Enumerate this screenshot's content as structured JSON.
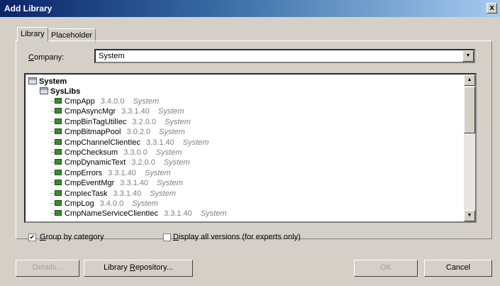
{
  "window": {
    "title": "Add Library",
    "close": "x"
  },
  "tabs": [
    {
      "label": "Library"
    },
    {
      "label": "Placeholder"
    }
  ],
  "company": {
    "label_u": "C",
    "label_rest": "ompany:",
    "value": "System",
    "dropdown_glyph": "▼"
  },
  "scroll": {
    "up": "▲",
    "down": "▼"
  },
  "tree": {
    "root": "System",
    "category": "SysLibs",
    "items": [
      {
        "name": "CmpApp",
        "version": "3.4.0.0",
        "vendor": "System"
      },
      {
        "name": "CmpAsyncMgr",
        "version": "3.3.1.40",
        "vendor": "System"
      },
      {
        "name": "CmpBinTagUtilIec",
        "version": "3.2.0.0",
        "vendor": "System"
      },
      {
        "name": "CmpBitmapPool",
        "version": "3.0.2.0",
        "vendor": "System"
      },
      {
        "name": "CmpChannelClientIec",
        "version": "3.3.1.40",
        "vendor": "System"
      },
      {
        "name": "CmpChecksum",
        "version": "3.3.0.0",
        "vendor": "System"
      },
      {
        "name": "CmpDynamicText",
        "version": "3.2.0.0",
        "vendor": "System"
      },
      {
        "name": "CmpErrors",
        "version": "3.3.1.40",
        "vendor": "System"
      },
      {
        "name": "CmpEventMgr",
        "version": "3.3.1.40",
        "vendor": "System"
      },
      {
        "name": "CmpIecTask",
        "version": "3.3.1.40",
        "vendor": "System"
      },
      {
        "name": "CmpLog",
        "version": "3.4.0.0",
        "vendor": "System"
      },
      {
        "name": "CmpNameServiceClientIec",
        "version": "3.3.1.40",
        "vendor": "System"
      }
    ]
  },
  "options": {
    "group": {
      "checked": true,
      "mark": "✔",
      "label_u": "G",
      "label_rest": "roup by category"
    },
    "all_versions": {
      "checked": false,
      "mark": "",
      "label_u": "D",
      "label_rest": "isplay all versions (for experts only)"
    }
  },
  "buttons": {
    "details": "Details...",
    "repository_pre": "Library ",
    "repository_u": "R",
    "repository_post": "epository...",
    "ok": "OK",
    "cancel": "Cancel"
  }
}
